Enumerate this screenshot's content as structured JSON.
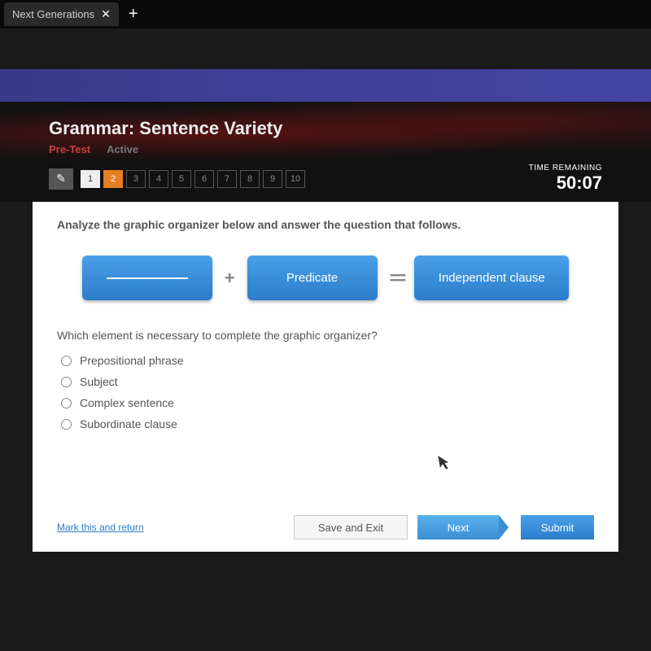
{
  "browser": {
    "tab_title": "Next Generations",
    "close_glyph": "✕",
    "add_glyph": "+"
  },
  "header": {
    "title": "Grammar: Sentence Variety",
    "tabs": {
      "pre_test": "Pre-Test",
      "active": "Active"
    },
    "pencil_glyph": "✎",
    "questions": [
      "1",
      "2",
      "3",
      "4",
      "5",
      "6",
      "7",
      "8",
      "9",
      "10"
    ],
    "timer_label": "TIME REMAINING",
    "timer_value": "50:07"
  },
  "content": {
    "instruction": "Analyze the graphic organizer below and answer the question that follows.",
    "organizer": {
      "plus": "+",
      "predicate": "Predicate",
      "equals": "=",
      "independent": "Independent clause"
    },
    "question": "Which element is necessary to complete the graphic organizer?",
    "options": [
      "Prepositional phrase",
      "Subject",
      "Complex sentence",
      "Subordinate clause"
    ],
    "cursor_glyph": "↖"
  },
  "footer": {
    "mark_link": "Mark this and return",
    "save_exit": "Save and Exit",
    "next": "Next",
    "submit": "Submit"
  }
}
